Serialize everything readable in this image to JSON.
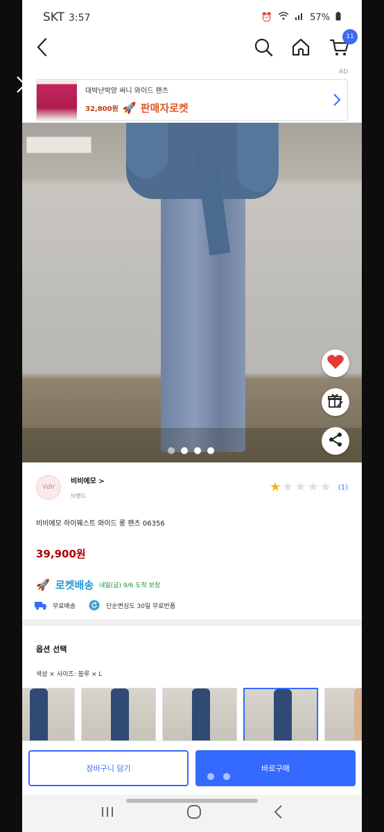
{
  "status_bar": {
    "carrier": "SKT",
    "time": "3:57",
    "battery": "57%"
  },
  "ad": {
    "label": "AD",
    "title": "대박난박양 써니 와이드 팬츠",
    "price": "32,800원",
    "badge": "판매자로켓"
  },
  "header": {
    "cart_badge": "11"
  },
  "photo": {
    "dots_total": 4,
    "active_dot": 1
  },
  "brand": {
    "logo_text": "VdV",
    "name": "비비에모 >",
    "sub": "브랜드",
    "rating_stars": 1,
    "rating_max": 5,
    "review_count": "(1)"
  },
  "product": {
    "title": "비비에모 하이웨스트 와이드 롱 팬츠 06356",
    "price": "39,900원"
  },
  "delivery": {
    "rocket_label": "로켓배송",
    "eta": "내일(금) 9/6 도착 보장",
    "free_shipping": "무료배송",
    "return_policy": "단순변심도 30일 무료반품"
  },
  "options": {
    "title": "옵션 선택",
    "desc": "색상 × 사이즈: 블루 × L"
  },
  "actions": {
    "cart_button": "장바구니 담기",
    "buy_button": "바로구매"
  },
  "colors": {
    "accent": "#346aff",
    "price": "#ae0000",
    "rocket": "#1d9bd3"
  }
}
